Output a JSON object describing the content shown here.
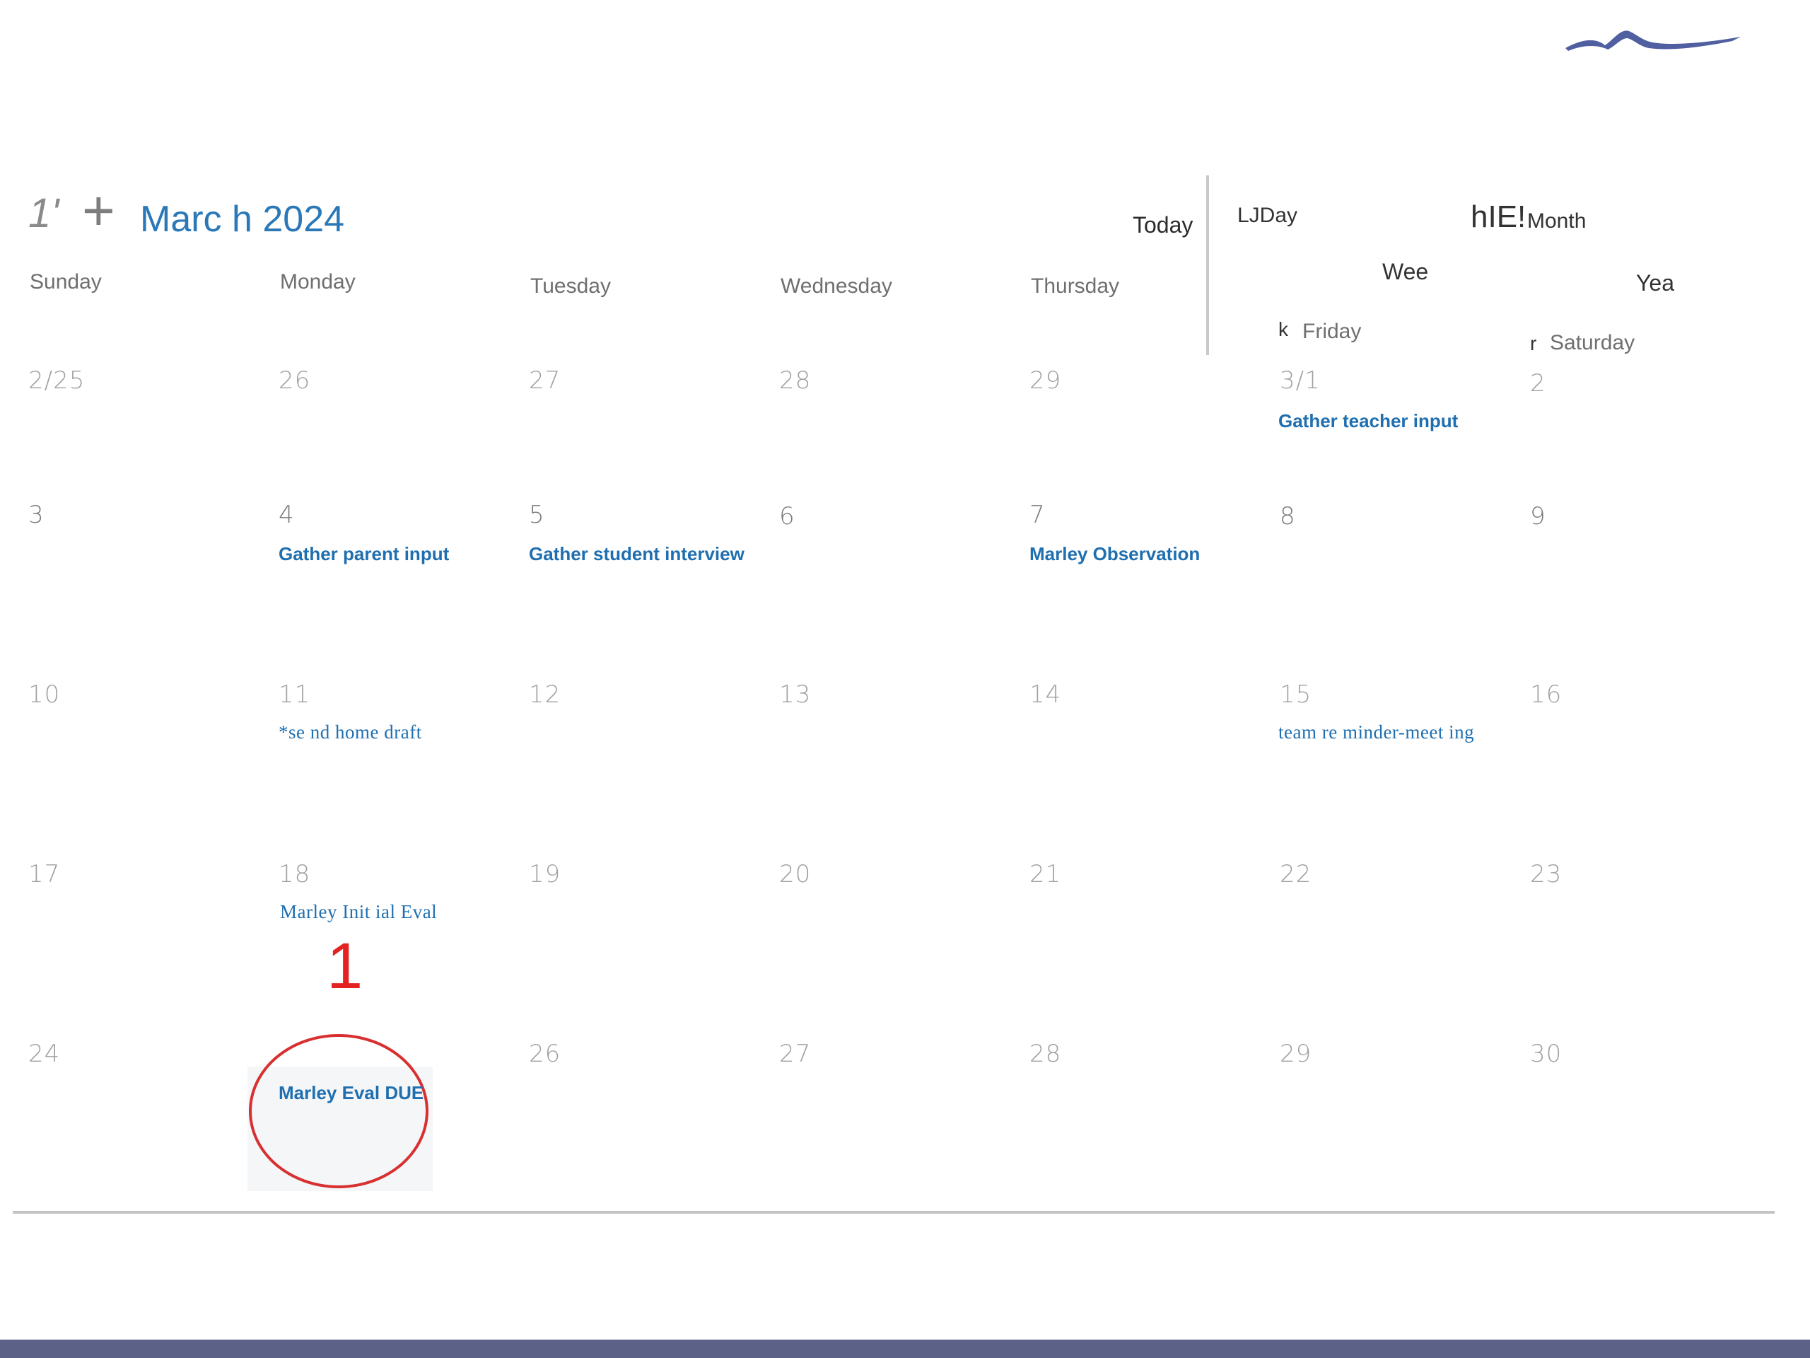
{
  "header": {
    "back_glyph": "1'",
    "add_glyph": "+",
    "month_title": "Marc h 2024",
    "today_label": "Today"
  },
  "views": {
    "day_label": "LJDay",
    "icon_text": "hIE!",
    "month_label": "Month",
    "week_label": "Wee",
    "year_label": "Yea",
    "week_fragment": "k",
    "year_fragment": "r"
  },
  "weekdays": [
    "Sunday",
    "Monday",
    "Tuesday",
    "Wednesday",
    "Thursday",
    "Friday",
    "Saturday"
  ],
  "weeks": [
    [
      "2/25",
      "26",
      "27",
      "28",
      "29",
      "3/1",
      "2"
    ],
    [
      "3",
      "4",
      "5",
      "6",
      "7",
      "8",
      "9"
    ],
    [
      "10",
      "11",
      "12",
      "13",
      "14",
      "15",
      "16"
    ],
    [
      "17",
      "18",
      "19",
      "20",
      "21",
      "22",
      "23"
    ],
    [
      "24",
      "",
      "26",
      "27",
      "28",
      "29",
      "30"
    ]
  ],
  "events": {
    "gather_teacher_input": "Gather teacher input",
    "gather_parent_input": "Gather parent input",
    "gather_student_interview": "Gather student interview",
    "marley_observation": "Marley Observation",
    "send_home_draft": "*se nd home draft",
    "team_reminder_meeting": "team re minder-meet ing",
    "marley_initial_eval": "Marley Init ial Eval",
    "marley_eval_due": "Marley Eval DUE"
  },
  "annotations": {
    "marker_number": "1"
  },
  "colors": {
    "accent_blue": "#2a78b8",
    "event_blue": "#1f6fb0",
    "annotation_red": "#e32322",
    "logo_blue": "#4f5fa0",
    "footer_bar": "#5b6187"
  }
}
